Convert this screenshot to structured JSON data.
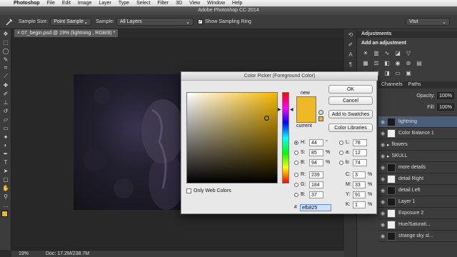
{
  "menubar": {
    "apple": "",
    "items": [
      "Photoshop",
      "File",
      "Edit",
      "Image",
      "Layer",
      "Type",
      "Select",
      "Filter",
      "3D",
      "View",
      "Window",
      "Help"
    ]
  },
  "window": {
    "title": "Adobe Photoshop CC 2014"
  },
  "options": {
    "sample_size_label": "Sample Size:",
    "sample_size_value": "Point Sample",
    "sample_label": "Sample:",
    "sample_value": "All Layers",
    "show_ring_label": "Show Sampling Ring",
    "workspace_value": "Vtut"
  },
  "document": {
    "tab": "07_begin.psd @ 19% (lightning , RGB/8) *"
  },
  "status": {
    "zoom": "19%",
    "doc": "Doc: 17.2M/238.7M"
  },
  "dialog": {
    "title": "Color Picker (Foreground Color)",
    "new_label": "new",
    "current_label": "current",
    "ok": "OK",
    "cancel": "Cancel",
    "add_swatches": "Add to Swatches",
    "color_libraries": "Color Libraries",
    "only_web": "Only Web Colors",
    "hsb": [
      {
        "label": "H:",
        "value": "44",
        "unit": "°"
      },
      {
        "label": "S:",
        "value": "85",
        "unit": "%"
      },
      {
        "label": "B:",
        "value": "94",
        "unit": "%"
      }
    ],
    "rgb": [
      {
        "label": "R:",
        "value": "239"
      },
      {
        "label": "G:",
        "value": "184"
      },
      {
        "label": "B:",
        "value": "37"
      }
    ],
    "lab": [
      {
        "label": "L:",
        "value": "78"
      },
      {
        "label": "a:",
        "value": "12"
      },
      {
        "label": "b:",
        "value": "74"
      }
    ],
    "cmyk": [
      {
        "label": "C:",
        "value": "3",
        "unit": "%"
      },
      {
        "label": "M:",
        "value": "33",
        "unit": "%"
      },
      {
        "label": "Y:",
        "value": "91",
        "unit": "%"
      },
      {
        "label": "K:",
        "value": "1",
        "unit": "%"
      }
    ],
    "hex_label": "#",
    "hex": "efb825",
    "color": "#efb825"
  },
  "panels": {
    "adjustments_tab": "Adjustments",
    "add_adjustment": "Add an adjustment",
    "channels_tab": "Channels",
    "paths_tab": "Paths",
    "opacity_label": "Opacity:",
    "opacity_value": "100%",
    "fill_label": "Fill:",
    "fill_value": "100%",
    "layers": [
      {
        "name": "lightning",
        "selected": true,
        "thumb": "dark"
      },
      {
        "name": "Color Balance 1",
        "selected": false,
        "thumb": "white"
      },
      {
        "name": "flowers",
        "selected": false,
        "thumb": "none"
      },
      {
        "name": "SKULL",
        "selected": false,
        "thumb": "none"
      },
      {
        "name": "more details",
        "selected": false,
        "thumb": "dark"
      },
      {
        "name": "detail Right",
        "selected": false,
        "thumb": "white"
      },
      {
        "name": "detail Left",
        "selected": false,
        "thumb": "dark"
      },
      {
        "name": "Layer 1",
        "selected": false,
        "thumb": "dark"
      },
      {
        "name": "Exposure 2",
        "selected": false,
        "thumb": "white"
      },
      {
        "name": "Hue/Saturati...",
        "selected": false,
        "thumb": "white"
      },
      {
        "name": "strange sky sl...",
        "selected": false,
        "thumb": "dark"
      }
    ]
  }
}
